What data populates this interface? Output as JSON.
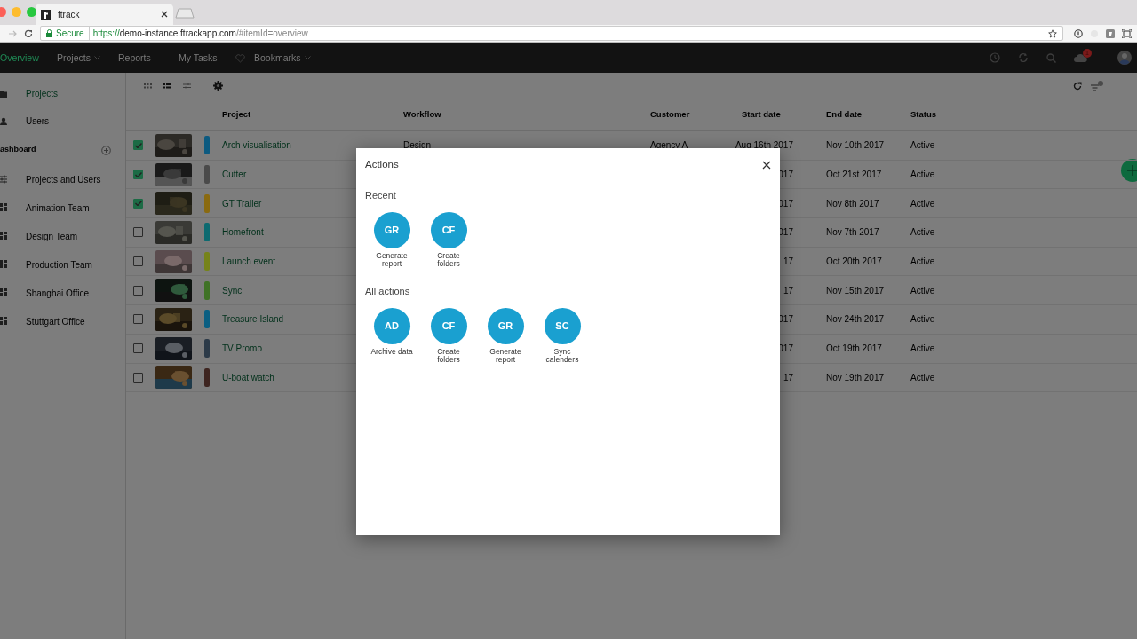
{
  "browser": {
    "tab_title": "ftrack",
    "secure_label": "Secure",
    "url_scheme": "https://",
    "url_host": "demo-instance.ftrackapp.com",
    "url_path": "/#itemId=overview"
  },
  "nav": {
    "items": [
      {
        "label": "Overview",
        "kind": "link",
        "selected": true
      },
      {
        "label": "Projects",
        "kind": "menu",
        "selected": false
      },
      {
        "label": "Reports",
        "kind": "link",
        "selected": false
      },
      {
        "label": "My Tasks",
        "kind": "link",
        "selected": false
      },
      {
        "label": "Bookmarks",
        "kind": "favorites-menu",
        "selected": false
      }
    ],
    "notification_badge": "1"
  },
  "toolbar": {
    "views": [
      {
        "kind": "grid",
        "selected": false
      },
      {
        "kind": "list",
        "selected": true
      },
      {
        "kind": "sliders",
        "selected": false
      }
    ]
  },
  "sidebar": {
    "items": [
      {
        "label": "Projects",
        "kind": "folder",
        "selected": true
      },
      {
        "label": "Users",
        "kind": "person",
        "selected": false
      }
    ],
    "section_title": "ashboard",
    "dashboards": [
      {
        "label": "Projects and Users",
        "kind": "sliders"
      },
      {
        "label": "Animation Team",
        "kind": "dashboard"
      },
      {
        "label": "Design Team",
        "kind": "dashboard"
      },
      {
        "label": "Production Team",
        "kind": "dashboard"
      },
      {
        "label": "Shanghai Office",
        "kind": "dashboard"
      },
      {
        "label": "Stuttgart Office",
        "kind": "dashboard"
      }
    ]
  },
  "table": {
    "columns": [
      "Project",
      "Workflow",
      "Customer",
      "Start date",
      "End date",
      "Status"
    ],
    "rows": [
      {
        "selected": true,
        "color": "#0c5a80",
        "name": "Arch visualisation",
        "workflow": "Design",
        "customer": "Agency A",
        "start_date": "Aug 16th 2017",
        "end_date": "Nov 10th 2017",
        "status": "Active"
      },
      {
        "selected": true,
        "color": "#4a4a4a",
        "name": "Cutter",
        "start_date": "017",
        "end_date": "Oct 21st 2017",
        "status": "Active"
      },
      {
        "selected": true,
        "color": "#8a6a10",
        "name": "GT Trailer",
        "start_date": "017",
        "end_date": "Nov 8th 2017",
        "status": "Active"
      },
      {
        "selected": false,
        "color": "#0d6a70",
        "name": "Homefront",
        "start_date": "017",
        "end_date": "Nov 7th 2017",
        "status": "Active"
      },
      {
        "selected": false,
        "color": "#76831a",
        "name": "Launch event",
        "start_date": "17",
        "end_date": "Oct 20th 2017",
        "status": "Active"
      },
      {
        "selected": false,
        "color": "#3f7226",
        "name": "Sync",
        "start_date": "17",
        "end_date": "Nov 15th 2017",
        "status": "Active"
      },
      {
        "selected": false,
        "color": "#0b5f82",
        "name": "Treasure Island",
        "start_date": "017",
        "end_date": "Nov 24th 2017",
        "status": "Active"
      },
      {
        "selected": false,
        "color": "#2c3a48",
        "name": "TV Promo",
        "start_date": "017",
        "end_date": "Oct 19th 2017",
        "status": "Active"
      },
      {
        "selected": false,
        "color": "#3e2520",
        "name": "U-boat watch",
        "start_date": "17",
        "end_date": "Nov 19th 2017",
        "status": "Active"
      }
    ]
  },
  "dialog": {
    "title": "Actions",
    "sections": [
      {
        "title": "Recent",
        "actions": [
          {
            "initials": "GR",
            "label": "Generate report"
          },
          {
            "initials": "CF",
            "label": "Create folders"
          }
        ]
      },
      {
        "title": "All actions",
        "actions": [
          {
            "initials": "AD",
            "label": "Archive data"
          },
          {
            "initials": "CF",
            "label": "Create folders"
          },
          {
            "initials": "GR",
            "label": "Generate report"
          },
          {
            "initials": "SC",
            "label": "Sync calenders"
          }
        ]
      }
    ]
  }
}
